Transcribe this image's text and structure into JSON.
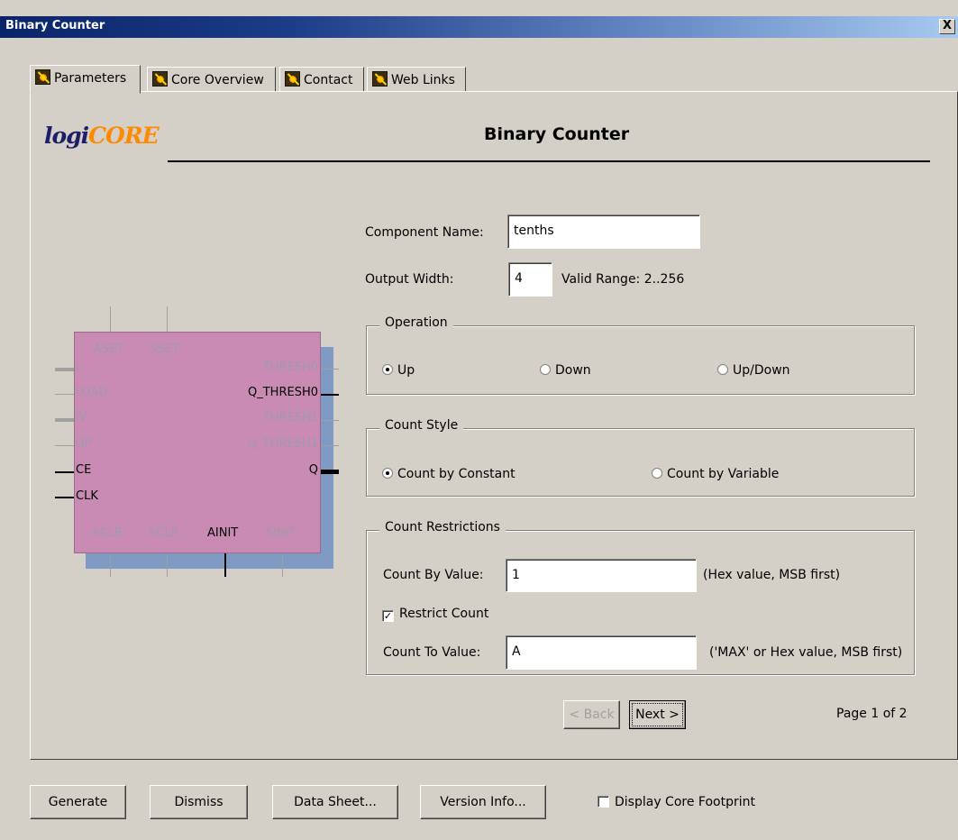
{
  "window": {
    "title": "Binary Counter",
    "close": "X"
  },
  "tabs": [
    {
      "label": "Parameters",
      "active": true
    },
    {
      "label": "Core Overview",
      "active": false
    },
    {
      "label": "Contact",
      "active": false
    },
    {
      "label": "Web Links",
      "active": false
    }
  ],
  "header": {
    "logo_prefix": "logi",
    "logo_core": "CORE",
    "title": "Binary Counter"
  },
  "symbol": {
    "top_pins": [
      "ASET",
      "SSET"
    ],
    "left_pins": [
      {
        "name": "L",
        "active": false,
        "bus": true
      },
      {
        "name": "LOAD",
        "active": false,
        "bus": false
      },
      {
        "name": "IV",
        "active": false,
        "bus": true
      },
      {
        "name": "UP",
        "active": false,
        "bus": false
      },
      {
        "name": "CE",
        "active": true,
        "bus": false
      },
      {
        "name": "CLK",
        "active": true,
        "bus": false
      }
    ],
    "right_pins": [
      {
        "name": "THRESH0",
        "active": false,
        "bus": false
      },
      {
        "name": "Q_THRESH0",
        "active": true,
        "bus": false
      },
      {
        "name": "THRESH1",
        "active": false,
        "bus": false
      },
      {
        "name": "Q_THRESH1",
        "active": false,
        "bus": false
      },
      {
        "name": "Q",
        "active": true,
        "bus": true
      }
    ],
    "bottom_pins": [
      {
        "name": "ACLR",
        "active": false
      },
      {
        "name": "SCLR",
        "active": false
      },
      {
        "name": "AINIT",
        "active": true
      },
      {
        "name": "SINIT",
        "active": false
      }
    ],
    "colors": {
      "body": "#c98bb3",
      "shadow": "#7f9bc4"
    }
  },
  "form": {
    "component_name_label": "Component Name:",
    "component_name_value": "tenths",
    "output_width_label": "Output Width:",
    "output_width_value": "4",
    "output_width_range": "Valid Range: 2..256",
    "operation": {
      "title": "Operation",
      "options": [
        "Up",
        "Down",
        "Up/Down"
      ],
      "selected": "Up"
    },
    "count_style": {
      "title": "Count Style",
      "options": [
        "Count by Constant",
        "Count by Variable"
      ],
      "selected": "Count by Constant"
    },
    "count_restrictions": {
      "title": "Count Restrictions",
      "count_by_label": "Count By Value:",
      "count_by_value": "1",
      "count_by_hint": "(Hex value, MSB first)",
      "restrict_label": "Restrict Count",
      "restrict_checked": true,
      "count_to_label": "Count To Value:",
      "count_to_value": "A",
      "count_to_hint": "('MAX' or Hex value, MSB first)"
    },
    "back_label": "< Back",
    "next_label": "Next >",
    "page_text": "Page 1 of 2"
  },
  "footer": {
    "generate": "Generate",
    "dismiss": "Dismiss",
    "data_sheet": "Data Sheet...",
    "version_info": "Version Info...",
    "footprint_label": "Display Core Footprint",
    "footprint_checked": false
  }
}
